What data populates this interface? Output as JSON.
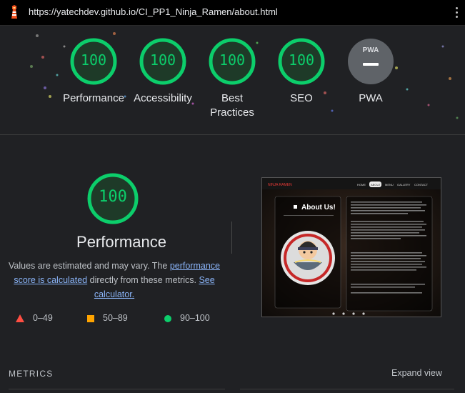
{
  "browser": {
    "url": "https://yatechdev.github.io/CI_PP1_Ninja_Ramen/about.html",
    "logo_icon": "lighthouse-icon",
    "menu_icon": "kebab-menu-icon"
  },
  "categories": [
    {
      "id": "performance",
      "score": "100",
      "label": "Performance"
    },
    {
      "id": "accessibility",
      "score": "100",
      "label": "Accessibility"
    },
    {
      "id": "best-practices",
      "score": "100",
      "label": "Best\nPractices"
    },
    {
      "id": "seo",
      "score": "100",
      "label": "SEO"
    },
    {
      "id": "pwa",
      "score": "",
      "label": "PWA",
      "badge": "PWA"
    }
  ],
  "main": {
    "score": "100",
    "title": "Performance",
    "desc_prefix": "Values are estimated and may vary. The ",
    "desc_link1": "performance score is calculated",
    "desc_middle": " directly from these metrics. ",
    "desc_link2": "See calculator."
  },
  "legend": [
    {
      "shape": "triangle",
      "range": "0–49",
      "color": "#ff4e42"
    },
    {
      "shape": "square",
      "range": "50–89",
      "color": "#ffa400"
    },
    {
      "shape": "circle",
      "range": "90–100",
      "color": "#0cce6b"
    }
  ],
  "thumbnail": {
    "brand": "NINJA RAMEN",
    "nav": [
      "HOME",
      "ABOUT",
      "MENU",
      "GALLERY",
      "CONTACT"
    ],
    "heading": "About Us!"
  },
  "footer": {
    "metrics_label": "METRICS",
    "expand_label": "Expand view"
  },
  "colors": {
    "pass": "#0cce6b",
    "average": "#ffa400",
    "fail": "#ff4e42",
    "background": "#202124"
  }
}
